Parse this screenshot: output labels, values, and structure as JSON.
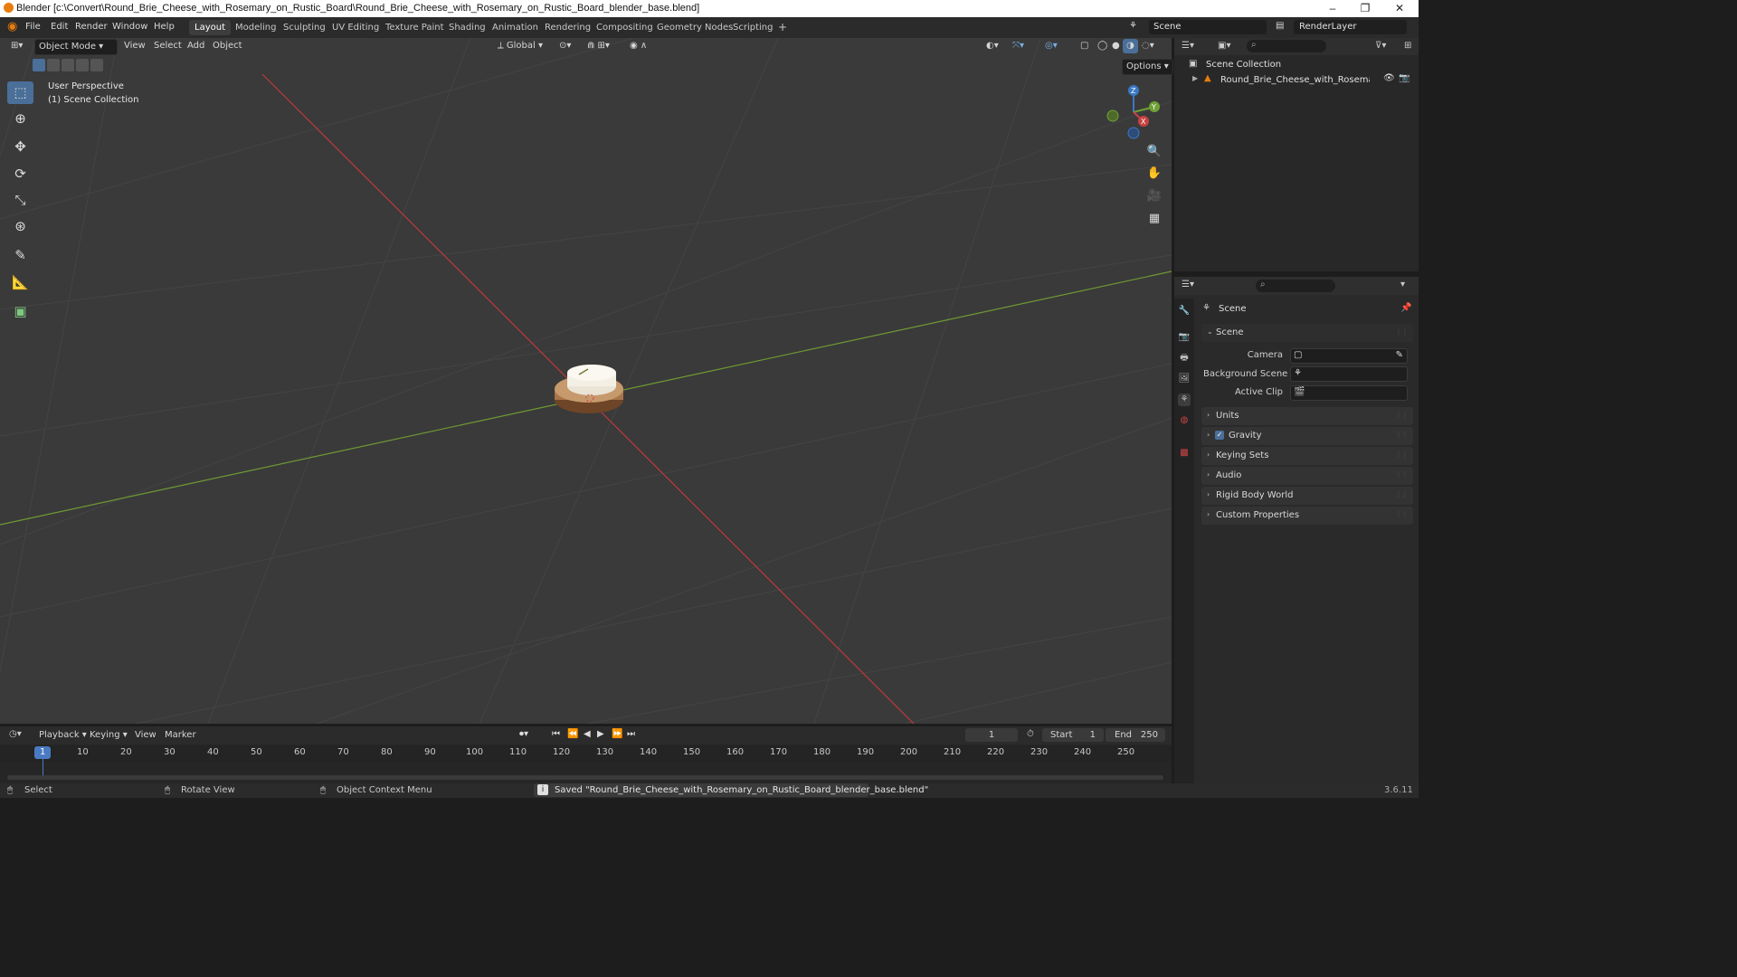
{
  "window": {
    "title": "Blender [c:\\Convert\\Round_Brie_Cheese_with_Rosemary_on_Rustic_Board\\Round_Brie_Cheese_with_Rosemary_on_Rustic_Board_blender_base.blend]",
    "minimize": "–",
    "maximize": "❐",
    "close": "✕"
  },
  "menu": [
    "File",
    "Edit",
    "Render",
    "Window",
    "Help"
  ],
  "workspaces": [
    "Layout",
    "Modeling",
    "Sculpting",
    "UV Editing",
    "Texture Paint",
    "Shading",
    "Animation",
    "Rendering",
    "Compositing",
    "Geometry Nodes",
    "Scripting",
    "+"
  ],
  "active_workspace": "Layout",
  "scene_selector": {
    "label": "Scene"
  },
  "renderlayer_selector": {
    "label": "RenderLayer"
  },
  "viewport_header": {
    "mode": "Object Mode",
    "view": "View",
    "select": "Select",
    "add": "Add",
    "object": "Object",
    "orientation": "Global",
    "options": "Options"
  },
  "viewport": {
    "perspective_label": "User Perspective",
    "collection_label": "(1) Scene Collection",
    "gizmo_axes": [
      "Z",
      "Y",
      "X"
    ],
    "grid_color": "#444444",
    "x_axis_color": "#c0393b",
    "y_axis_color": "#6f9a33"
  },
  "outliner": {
    "root": "Scene Collection",
    "item": "Round_Brie_Cheese_with_Rosemary_on"
  },
  "properties": {
    "header": "Scene",
    "scene_panel": "Scene",
    "fields": [
      {
        "label": "Camera"
      },
      {
        "label": "Background Scene"
      },
      {
        "label": "Active Clip"
      }
    ],
    "panels": [
      "Units",
      "Gravity",
      "Keying Sets",
      "Audio",
      "Rigid Body World",
      "Custom Properties"
    ],
    "gravity_checked": true
  },
  "timeline": {
    "playback": "Playback",
    "keying": "Keying",
    "view": "View",
    "marker": "Marker",
    "current_frame": "1",
    "start_label": "Start",
    "start_value": "1",
    "end_label": "End",
    "end_value": "250",
    "ticks": [
      "1",
      "10",
      "20",
      "30",
      "40",
      "50",
      "60",
      "70",
      "80",
      "90",
      "100",
      "110",
      "120",
      "130",
      "140",
      "150",
      "160",
      "170",
      "180",
      "190",
      "200",
      "210",
      "220",
      "230",
      "240",
      "250"
    ]
  },
  "statusbar": {
    "select": "Select",
    "rotate": "Rotate View",
    "context": "Object Context Menu",
    "message": "Saved \"Round_Brie_Cheese_with_Rosemary_on_Rustic_Board_blender_base.blend\"",
    "version": "3.6.11"
  }
}
